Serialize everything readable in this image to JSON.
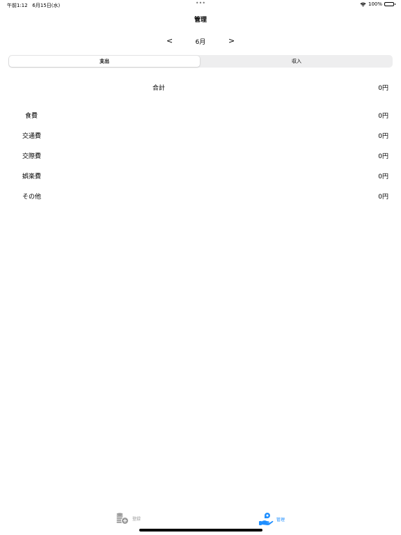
{
  "status_bar": {
    "time": "午前1:12",
    "date": "6月15日(水)",
    "battery": "100%",
    "dots": "•••"
  },
  "nav": {
    "title": "管理"
  },
  "month": {
    "prev": "<",
    "label": "6月",
    "next": ">"
  },
  "segments": [
    {
      "label": "支出",
      "selected": true
    },
    {
      "label": "収入",
      "selected": false
    }
  ],
  "total": {
    "label": "合計",
    "value": "0円"
  },
  "categories": [
    {
      "label": "食費",
      "value": "0円"
    },
    {
      "label": "交通費",
      "value": "0円"
    },
    {
      "label": "交際費",
      "value": "0円"
    },
    {
      "label": "娯楽費",
      "value": "0円"
    },
    {
      "label": "その他",
      "value": "0円"
    }
  ],
  "tabs": [
    {
      "label": "登録",
      "icon": "coins-add-icon",
      "active": false
    },
    {
      "label": "管理",
      "icon": "hand-coin-icon",
      "active": true
    }
  ],
  "colors": {
    "accent": "#1f8fff",
    "inactive_tab": "#9a9a9a",
    "segment_bg": "#eeeeef"
  }
}
